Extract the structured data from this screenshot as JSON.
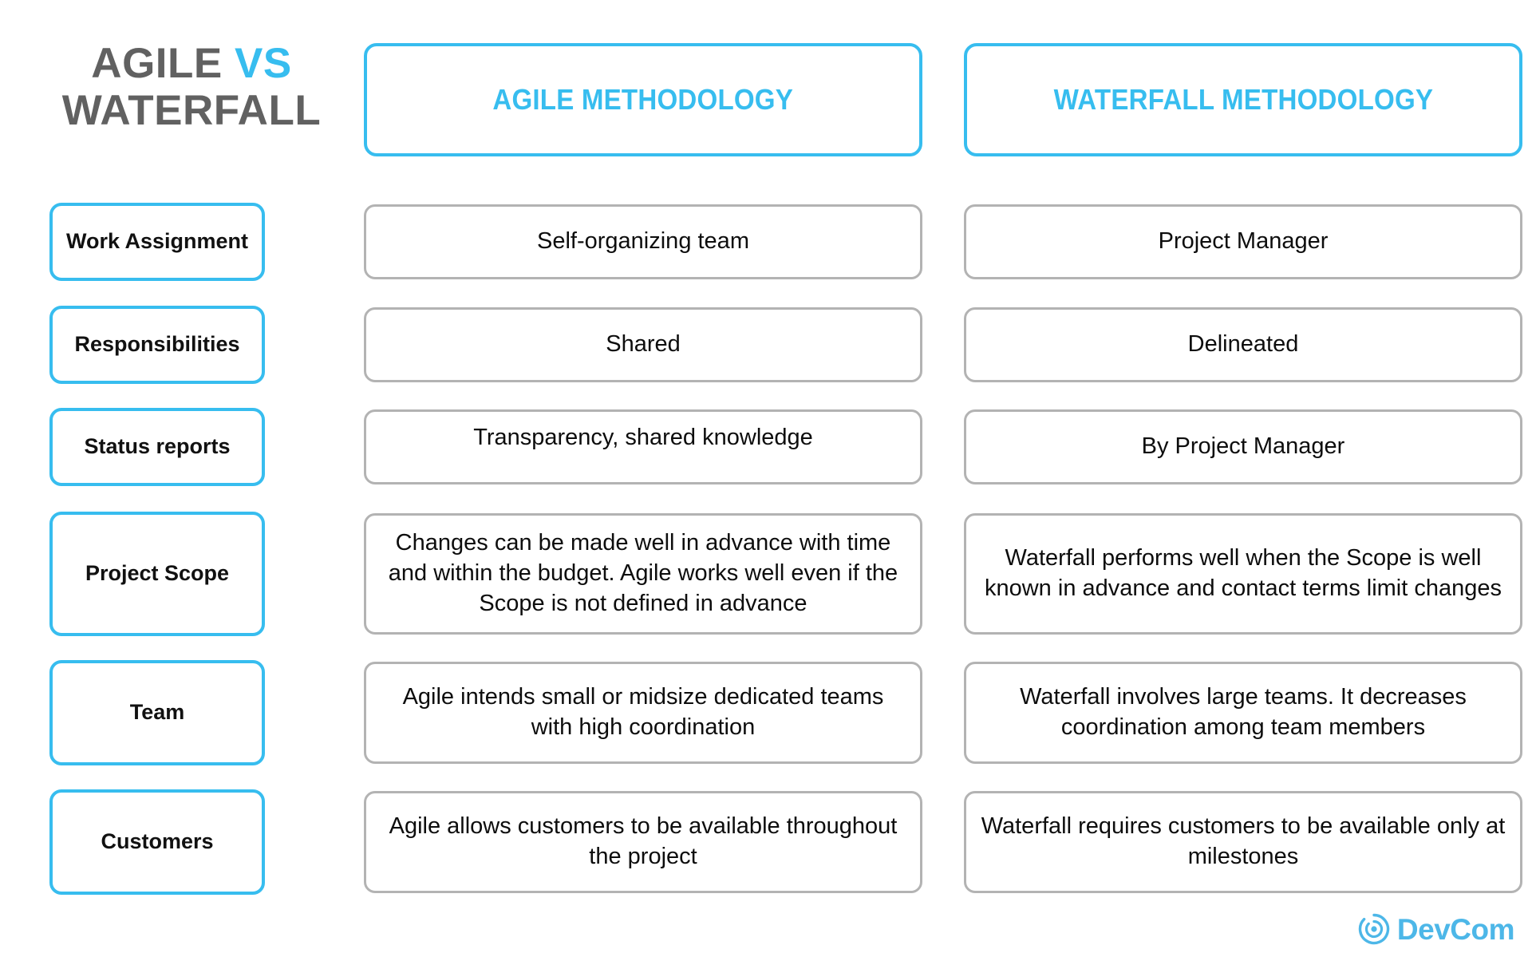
{
  "title": {
    "line1_main": "AGILE",
    "line1_accent": "VS",
    "line2": "WATERFALL"
  },
  "colors": {
    "accent_cyan": "#37bdef",
    "title_gray": "#616161",
    "cell_border_gray": "#b3b3b3",
    "text_black": "#0d0d0d",
    "logo_blue": "#4db7e8"
  },
  "columns": {
    "label_header": "",
    "agile_header": "AGILE METHODOLOGY",
    "waterfall_header": "WATERFALL METHODOLOGY"
  },
  "rows": [
    {
      "label": "Work Assignment",
      "agile": "Self-organizing team",
      "waterfall": "Project Manager"
    },
    {
      "label": "Responsibilities",
      "agile": "Shared",
      "waterfall": "Delineated"
    },
    {
      "label": "Status reports",
      "agile": "Transparency, shared knowledge",
      "waterfall": "By Project Manager"
    },
    {
      "label": "Project Scope",
      "agile": "Changes can be made well in advance with time and within the budget. Agile works well even if the Scope is not defined in advance",
      "waterfall": "Waterfall performs well when the Scope is well known in advance and contact terms limit changes"
    },
    {
      "label": "Team",
      "agile": "Agile intends small or midsize dedicated teams with high coordination",
      "waterfall": "Waterfall involves large teams. It decreases coordination among team members"
    },
    {
      "label": "Customers",
      "agile": "Agile allows customers to be available throughout the project",
      "waterfall": "Waterfall requires customers to be available only at milestones"
    }
  ],
  "logo": {
    "name": "DevCom",
    "icon": "devcom-circle-icon"
  }
}
